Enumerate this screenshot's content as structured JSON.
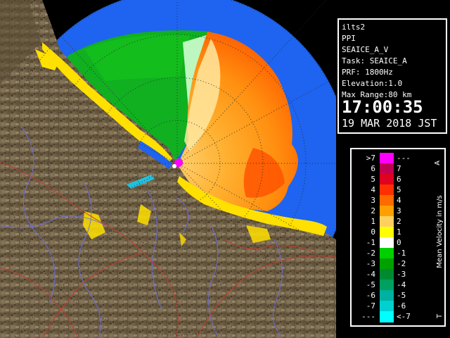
{
  "info": {
    "station": "ilts2",
    "product": "PPI",
    "task": "SEAICE_A_V",
    "task_line": "Task: SEAICE_A",
    "prf": "PRF: 1800Hz",
    "elevation": "Elevation:1.0",
    "max_range": "Max Range:80 km",
    "time": "17:00:35",
    "date": "19 MAR 2018 JST"
  },
  "legend": {
    "title": "Mean Velocity in m/s",
    "top_mark": "A",
    "bottom_mark": "T",
    "rows": [
      {
        "left": ">7",
        "right": "---",
        "color": "#ff00ff"
      },
      {
        "left": "6",
        "right": "7",
        "color": "#c00050"
      },
      {
        "left": "5",
        "right": "6",
        "color": "#e00020"
      },
      {
        "left": "4",
        "right": "5",
        "color": "#ff3000"
      },
      {
        "left": "3",
        "right": "4",
        "color": "#ff6a00"
      },
      {
        "left": "2",
        "right": "3",
        "color": "#ffa000"
      },
      {
        "left": "1",
        "right": "2",
        "color": "#ffd060"
      },
      {
        "left": "0",
        "right": "1",
        "color": "#ffff00"
      },
      {
        "left": "-1",
        "right": "0",
        "color": "#ffffff"
      },
      {
        "left": "-2",
        "right": "-1",
        "color": "#00d000"
      },
      {
        "left": "-3",
        "right": "-2",
        "color": "#00a000"
      },
      {
        "left": "-4",
        "right": "-3",
        "color": "#008a30"
      },
      {
        "left": "-5",
        "right": "-4",
        "color": "#00a060"
      },
      {
        "left": "-6",
        "right": "-5",
        "color": "#00b0a0"
      },
      {
        "left": "-7",
        "right": "-6",
        "color": "#00d0d0"
      },
      {
        "left": "---",
        "right": "<-7",
        "color": "#00ffff"
      }
    ]
  }
}
